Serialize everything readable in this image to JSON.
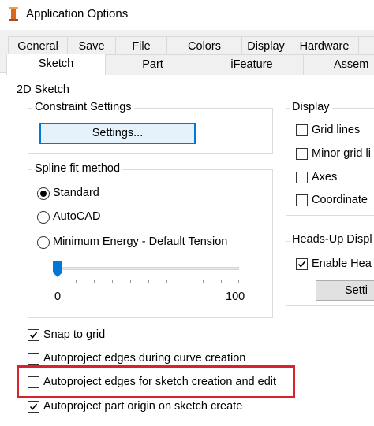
{
  "window": {
    "title": "Application Options"
  },
  "tabs_back": [
    "General",
    "Save",
    "File",
    "Colors",
    "Display",
    "Hardware"
  ],
  "tabs_front": [
    "Sketch",
    "Part",
    "iFeature",
    "Assem"
  ],
  "sketch_2d": {
    "section_title": "2D Sketch",
    "constraint_group": "Constraint Settings",
    "settings_button": "Settings...",
    "spline_group": "Spline fit method",
    "spline_options": [
      "Standard",
      "AutoCAD",
      "Minimum Energy - Default Tension"
    ],
    "spline_selected": "Standard",
    "slider_min": "0",
    "slider_max": "100",
    "slider_value": 0
  },
  "display_group": {
    "title": "Display",
    "items": [
      {
        "label": "Grid lines",
        "checked": false
      },
      {
        "label": "Minor grid li",
        "checked": false
      },
      {
        "label": "Axes",
        "checked": false
      },
      {
        "label": "Coordinate",
        "checked": false
      }
    ]
  },
  "headsup_group": {
    "title": "Heads-Up Displ",
    "enable_label": "Enable Hea",
    "enable_checked": true,
    "settings_button": "Setti"
  },
  "options": [
    {
      "label": "Snap to grid",
      "checked": true
    },
    {
      "label": "Autoproject edges during curve creation",
      "checked": false
    },
    {
      "label": "Autoproject edges for sketch creation and edit",
      "checked": false,
      "highlighted": true
    },
    {
      "label": "Autoproject part origin on sketch create",
      "checked": true
    }
  ],
  "colors": {
    "highlight": "#d9222e",
    "focus": "#0078d7",
    "slider_thumb": "#0078d7"
  }
}
